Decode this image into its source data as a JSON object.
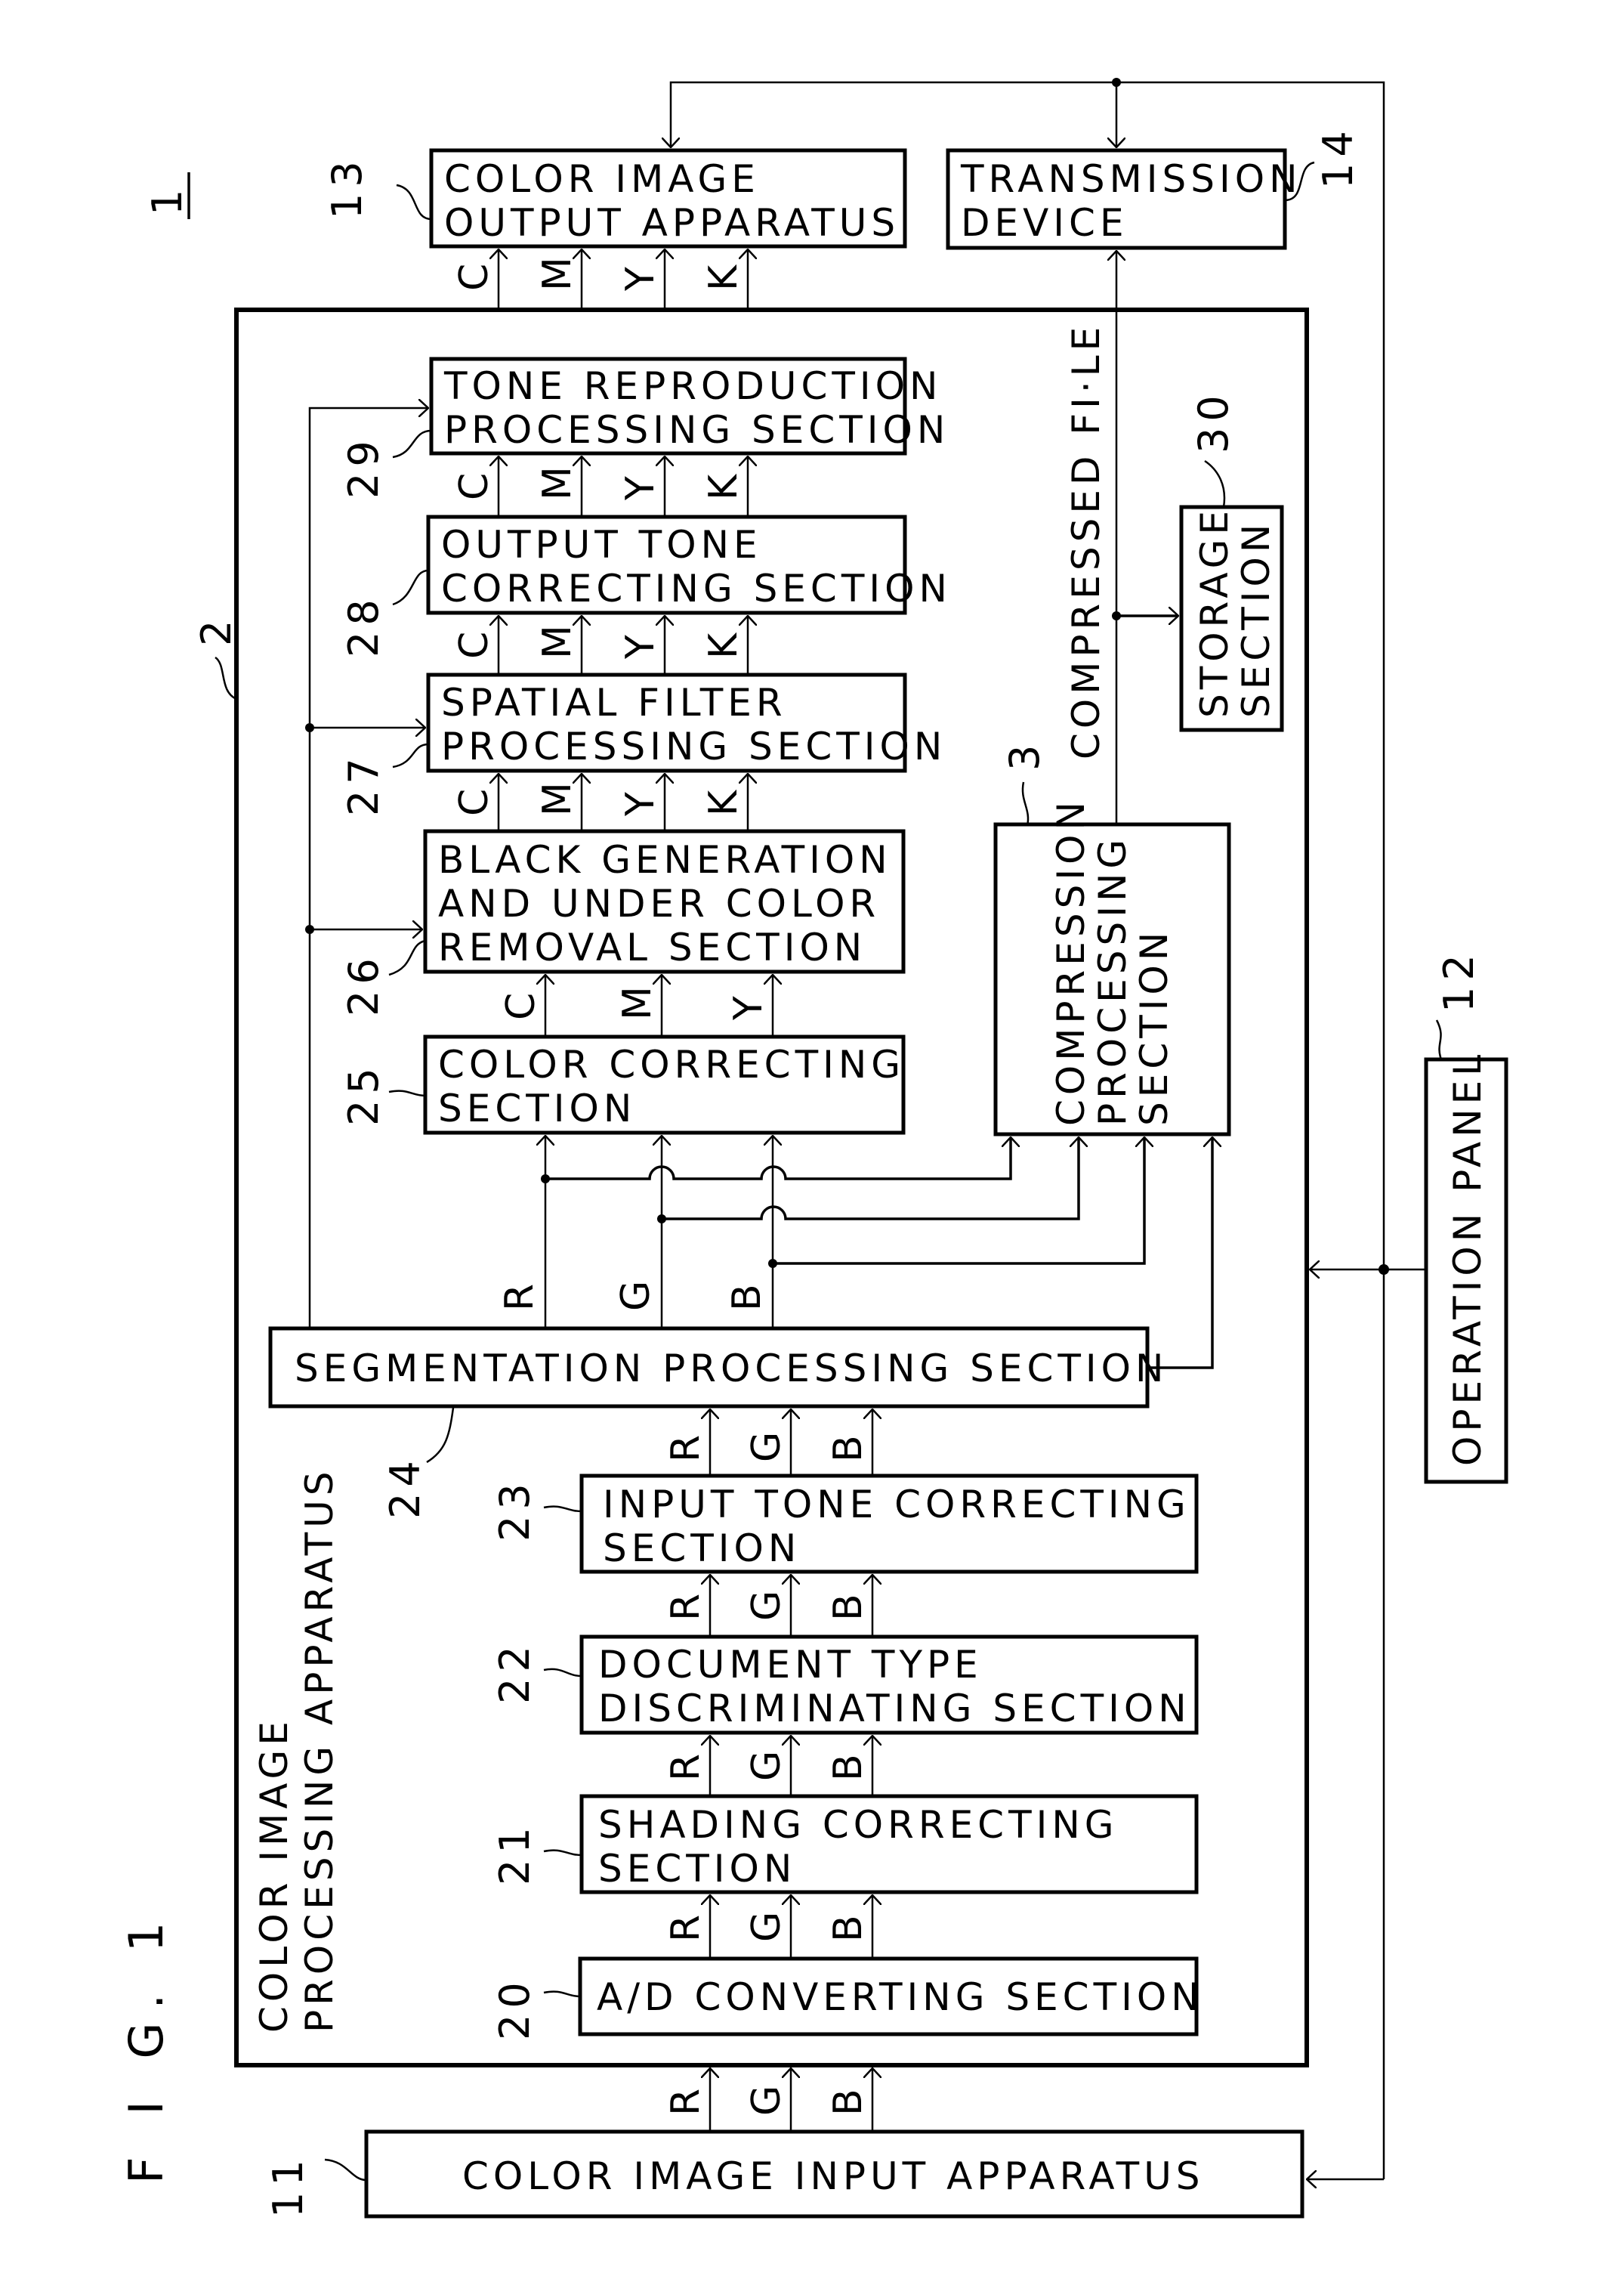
{
  "figure": {
    "title": "F I G. 1",
    "system_ref": "1"
  },
  "blocks": {
    "color_image_output": {
      "ref": "13",
      "lines": [
        "COLOR  IMAGE",
        "OUTPUT  APPARATUS"
      ]
    },
    "transmission_device": {
      "ref": "14",
      "lines": [
        "TRANSMISSION",
        "DEVICE"
      ]
    },
    "processing_apparatus": {
      "ref": "2",
      "lines": [
        "COLOR  IMAGE",
        "PROCESSING APPARATUS"
      ]
    },
    "tone_reproduction": {
      "ref": "29",
      "lines": [
        "TONE  REPRODUCTION",
        "PROCESSING  SECTION"
      ]
    },
    "output_tone": {
      "ref": "28",
      "lines": [
        "OUTPUT  TONE",
        "CORRECTING  SECTION"
      ]
    },
    "spatial_filter": {
      "ref": "27",
      "lines": [
        "SPATIAL  FILTER",
        "PROCESSING  SECTION"
      ]
    },
    "black_generation": {
      "ref": "26",
      "lines": [
        "BLACK  GENERATION",
        "AND  UNDER  COLOR",
        "REMOVAL  SECTION"
      ]
    },
    "color_correcting": {
      "ref": "25",
      "lines": [
        "COLOR  CORRECTING",
        "SECTION"
      ]
    },
    "compression": {
      "ref": "3",
      "lines": [
        "COMPRESSION",
        "PROCESSING",
        "SECTION"
      ]
    },
    "storage": {
      "ref": "30",
      "lines": [
        "STORAGE",
        "SECTION"
      ]
    },
    "segmentation": {
      "ref": "24",
      "lines": [
        "SEGMENTATION  PROCESSING  SECTION"
      ]
    },
    "input_tone": {
      "ref": "23",
      "lines": [
        "INPUT  TONE  CORRECTING",
        "SECTION"
      ]
    },
    "document_type": {
      "ref": "22",
      "lines": [
        "DOCUMENT  TYPE",
        "DISCRIMINATING  SECTION"
      ]
    },
    "shading": {
      "ref": "21",
      "lines": [
        "SHADING  CORRECTING",
        "SECTION"
      ]
    },
    "ad_converting": {
      "ref": "20",
      "lines": [
        "A/D  CONVERTING  SECTION"
      ]
    },
    "color_image_input": {
      "ref": "11",
      "lines": [
        "COLOR  IMAGE  INPUT  APPARATUS"
      ]
    },
    "operation_panel": {
      "ref": "12",
      "lines": [
        "OPERATION  PANEL"
      ]
    }
  },
  "connections": {
    "compressed_file_label": "COMPRESSED  FI·LE",
    "cmyk": [
      "C",
      "M",
      "Y",
      "K"
    ],
    "cmy": [
      "C",
      "M",
      "Y"
    ],
    "rgb": [
      "R",
      "G",
      "B"
    ]
  }
}
